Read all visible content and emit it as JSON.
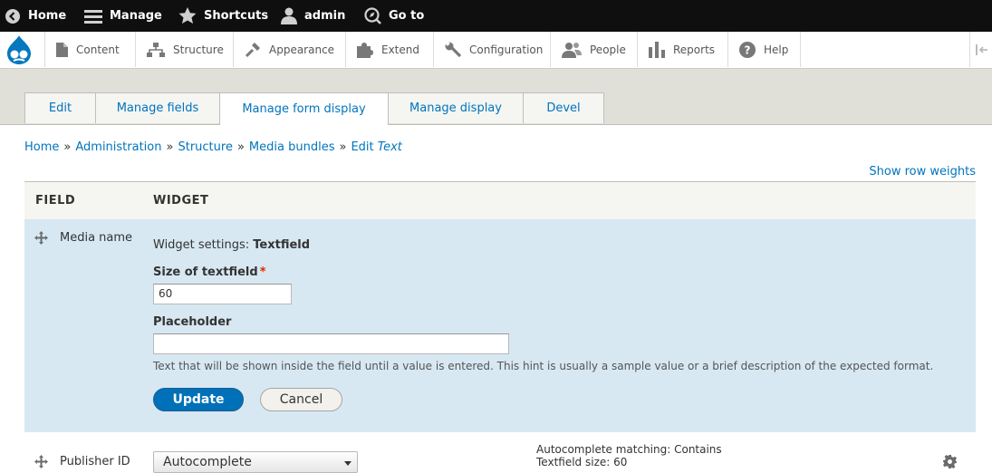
{
  "toolbar": {
    "home": "Home",
    "manage": "Manage",
    "shortcuts": "Shortcuts",
    "user": "admin",
    "goto": "Go to"
  },
  "tray": {
    "items": [
      "Content",
      "Structure",
      "Appearance",
      "Extend",
      "Configuration",
      "People",
      "Reports",
      "Help"
    ]
  },
  "tabs": [
    "Edit",
    "Manage fields",
    "Manage form display",
    "Manage display",
    "Devel"
  ],
  "active_tab": "Manage form display",
  "breadcrumb": {
    "items": [
      "Home",
      "Administration",
      "Structure",
      "Media bundles"
    ],
    "separator": "»",
    "current_prefix": "Edit",
    "current_italic": "Text"
  },
  "show_row_weights": "Show row weights",
  "table": {
    "col_field": "FIELD",
    "col_widget": "WIDGET"
  },
  "edit_row": {
    "field_name": "Media name",
    "widget_settings_prefix": "Widget settings:",
    "widget_name": "Textfield",
    "size_label": "Size of textfield",
    "size_required_mark": "*",
    "size_value": "60",
    "placeholder_label": "Placeholder",
    "placeholder_value": "",
    "placeholder_description": "Text that will be shown inside the field until a value is entered. This hint is usually a sample value or a brief description of the expected format.",
    "update_button": "Update",
    "cancel_button": "Cancel"
  },
  "row2": {
    "field_name": "Publisher ID",
    "widget_select": "Autocomplete",
    "summary_line1": "Autocomplete matching: Contains",
    "summary_line2": "Textfield size: 60"
  },
  "colors": {
    "toolbar_bg": "#0f0f0f",
    "link": "#0074bd",
    "edit_row_bg": "#d7e8f2",
    "primary_button": "#0071b8",
    "header_bg": "#e0e0d8"
  }
}
